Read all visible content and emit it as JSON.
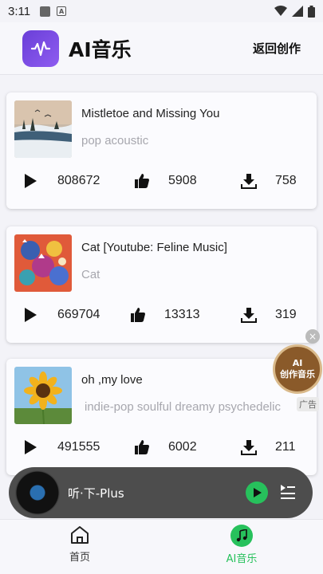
{
  "status_bar": {
    "time": "3:11"
  },
  "header": {
    "title": "AI音乐",
    "back_label": "返回创作"
  },
  "songs": [
    {
      "title": "Mistletoe and Missing You",
      "tags": "pop acoustic",
      "plays": "808672",
      "likes": "5908",
      "downloads": "758"
    },
    {
      "title": "Cat [Youtube: Feline Music]",
      "tags": "Cat",
      "plays": "669704",
      "likes": "13313",
      "downloads": "319"
    },
    {
      "title": "oh ,my love",
      "tags": "indie-pop soulful  dreamy psychedelic",
      "plays": "491555",
      "likes": "6002",
      "downloads": "211"
    }
  ],
  "ad": {
    "line1": "AI",
    "line2": "创作音乐",
    "badge": "广告"
  },
  "player": {
    "name": "听·下-Plus"
  },
  "tabs": [
    {
      "label": "首页",
      "active": false
    },
    {
      "label": "AI音乐",
      "active": true
    }
  ],
  "colors": {
    "accent": "#27c15c",
    "logo": "#7b4fe6",
    "player_bg": "#4d4d4d"
  }
}
